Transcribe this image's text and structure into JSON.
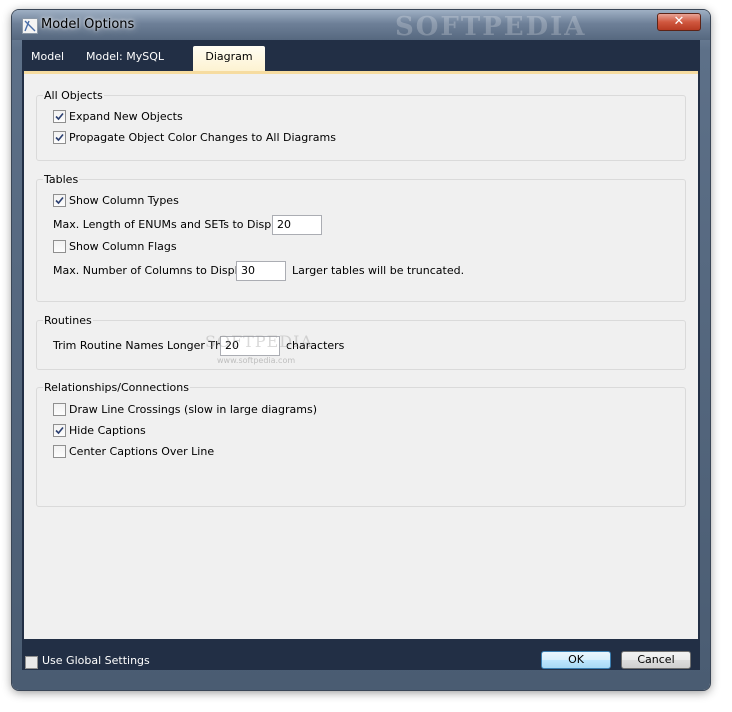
{
  "window": {
    "title": "Model Options",
    "watermark": "SOFTPEDIA",
    "close_glyph": "✕"
  },
  "tabs": [
    {
      "label": "Model"
    },
    {
      "label": "Model: MySQL"
    },
    {
      "label": "Diagram"
    }
  ],
  "all_objects": {
    "title": "All Objects",
    "expand_new_objects": {
      "label": "Expand New Objects",
      "checked": true
    },
    "propagate_color": {
      "label": "Propagate Object Color Changes to All Diagrams",
      "checked": true
    }
  },
  "tables": {
    "title": "Tables",
    "show_column_types": {
      "label": "Show Column Types",
      "checked": true
    },
    "max_enum_label": "Max. Length of ENUMs and SETs to Display:",
    "max_enum_value": "20",
    "show_column_flags": {
      "label": "Show Column Flags",
      "checked": false
    },
    "max_columns_label": "Max. Number of Columns to Display:",
    "max_columns_value": "30",
    "truncate_note": "Larger tables will be truncated."
  },
  "routines": {
    "title": "Routines",
    "trim_label": "Trim Routine Names Longer Than",
    "trim_value": "20",
    "trim_suffix": "characters",
    "watermark": "SOFTPEDIA",
    "watermark_url": "www.softpedia.com"
  },
  "relationships": {
    "title": "Relationships/Connections",
    "draw_line_crossings": {
      "label": "Draw Line Crossings (slow in large diagrams)",
      "checked": false
    },
    "hide_captions": {
      "label": "Hide Captions",
      "checked": true
    },
    "center_captions": {
      "label": "Center Captions Over Line",
      "checked": false
    }
  },
  "footer": {
    "use_global_settings": {
      "label": "Use Global Settings",
      "checked": false
    },
    "ok_label": "OK",
    "cancel_label": "Cancel"
  },
  "colors": {
    "window_frame": "#4a5c72",
    "client_background": "#222f45",
    "active_tab": "#fdf2d0",
    "pane_background": "#f0f0f0"
  },
  "icons": {
    "app": "app-icon",
    "close": "close-icon",
    "check": "checkmark-icon"
  }
}
